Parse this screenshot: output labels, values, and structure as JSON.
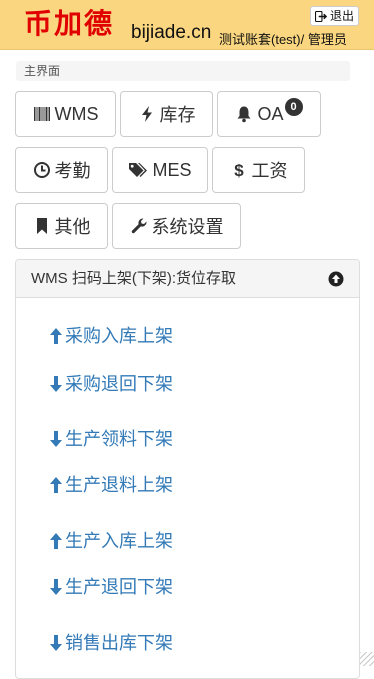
{
  "header": {
    "logo": "币加德",
    "domain": "bijiade.cn",
    "account": "测试账套(test)/ 管理员",
    "logout_label": "退出",
    "bg_color": "#f9d67f",
    "logo_color": "#e00000"
  },
  "breadcrumb": {
    "label": "主界面"
  },
  "nav": {
    "wms": {
      "label": "WMS",
      "icon": "barcode-icon"
    },
    "inventory": {
      "label": "库存",
      "icon": "bolt-icon"
    },
    "oa": {
      "label": "OA",
      "icon": "bell-icon",
      "badge": "0"
    },
    "attendance": {
      "label": "考勤",
      "icon": "clock-icon"
    },
    "mes": {
      "label": "MES",
      "icon": "tags-icon"
    },
    "salary": {
      "label": "工资",
      "icon": "dollar-icon"
    },
    "other": {
      "label": "其他",
      "icon": "bookmark-icon"
    },
    "settings": {
      "label": "系统设置",
      "icon": "wrench-icon"
    }
  },
  "panel": {
    "title": "WMS 扫码上架(下架):货位存取",
    "toggle_icon": "circle-arrow-up-icon",
    "link_color": "#337ab7",
    "links": [
      {
        "label": "采购入库上架",
        "direction": "up"
      },
      {
        "label": "采购退回下架",
        "direction": "down"
      },
      {
        "label": "生产领料下架",
        "direction": "down"
      },
      {
        "label": "生产退料上架",
        "direction": "up"
      },
      {
        "label": "生产入库上架",
        "direction": "up"
      },
      {
        "label": "生产退回下架",
        "direction": "down"
      },
      {
        "label": "销售出库下架",
        "direction": "down"
      }
    ]
  }
}
